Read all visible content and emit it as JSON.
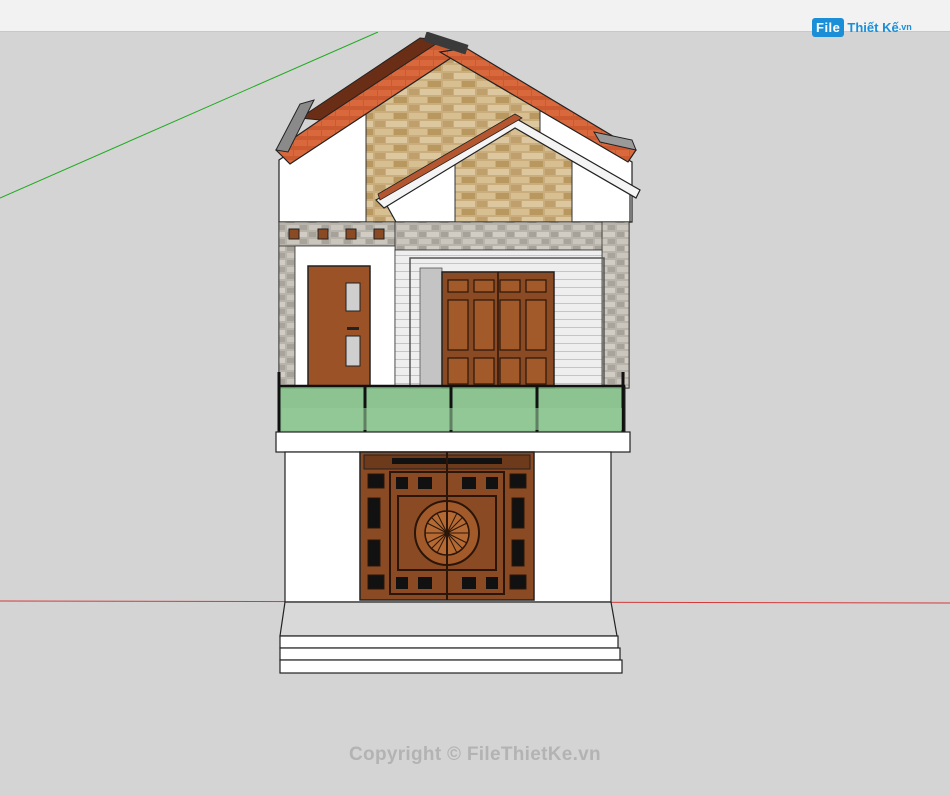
{
  "watermark": {
    "logo_box": "File",
    "logo_text": "Thiết Kế",
    "logo_domain": ".vn",
    "copyright": "Copyright © FileThietKe.vn"
  },
  "colors": {
    "viewport_bg": "#d4d4d4",
    "topbar_bg": "#f2f2f2",
    "axis_green": "#1faa1f",
    "axis_red": "#d43a3a",
    "roof_tile": "#c9542c",
    "wood_door": "#8a4a24",
    "stone": "#c8ab7a",
    "glass": "#7fbf85",
    "wall_white": "#ffffff"
  },
  "icons": [
    "logo-icon"
  ]
}
